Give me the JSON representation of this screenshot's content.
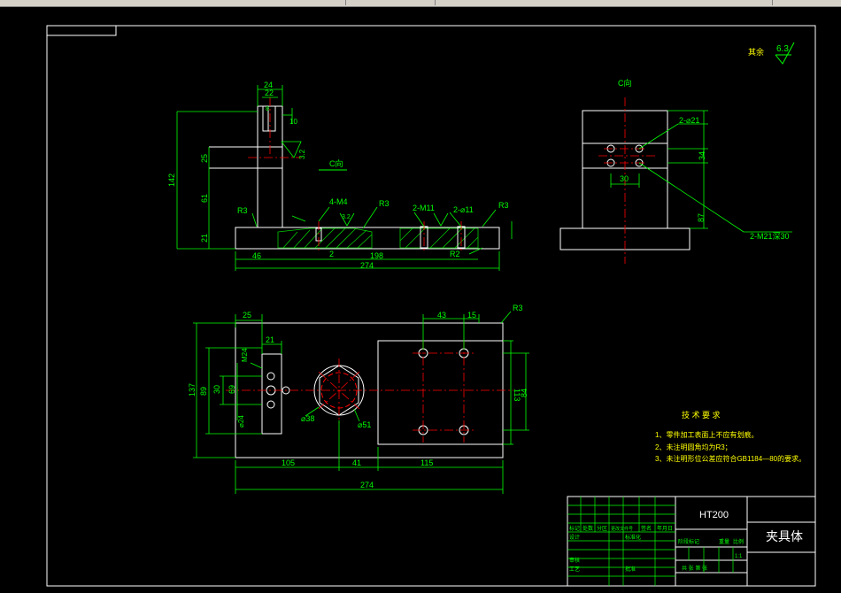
{
  "drawing": {
    "view_labels": {
      "c_view_top": "C向",
      "c_view_side": "C向"
    },
    "roughness": {
      "label": "其余",
      "value": "6.3"
    },
    "front_view": {
      "dims": {
        "d24": "24",
        "d22": "22",
        "d8": "8",
        "d10": "10",
        "d142": "142",
        "d25": "25",
        "d61": "61",
        "d21": "21",
        "d46": "46",
        "d198": "198",
        "d274": "274",
        "d2": "2",
        "d32": "3.2",
        "d32b": "3.2"
      },
      "callouts": {
        "r3_left": "R3",
        "m4": "4-M4",
        "r3_mid": "R3",
        "m11": "2-M11",
        "phi11": "2-⌀11",
        "r3_right": "R3",
        "r2": "R2"
      }
    },
    "side_view": {
      "callouts": {
        "phi21": "2-⌀21",
        "m21": "2-M21深30"
      },
      "dims": {
        "d30": "30",
        "d34": "34",
        "d87": "87"
      }
    },
    "plan_view": {
      "dims": {
        "d25": "25",
        "d21": "21",
        "d43": "43",
        "d15": "15",
        "d137": "137",
        "d89": "89",
        "d69": "69",
        "d30": "30",
        "d84": "84",
        "d113": "113",
        "d105": "105",
        "d41": "41",
        "d115": "115",
        "d274": "274",
        "phi38": "⌀38",
        "phi51": "⌀51",
        "m24": "M24",
        "phi24": "⌀24"
      },
      "callouts": {
        "r3": "R3"
      }
    },
    "tech_notes": {
      "title": "技 术 要 求",
      "items": [
        "1、零件加工表面上不应有划痕。",
        "2、未注明圆角均为R3；",
        "3、未注明形位公差应符合GB1184—80的要求。"
      ]
    },
    "title_block": {
      "material": "HT200",
      "part_name": "夹具体",
      "scale": "1:1",
      "cells": {
        "mark": "标记",
        "count": "处数",
        "zone": "分区",
        "change_doc": "更改文件号",
        "sign": "签名",
        "date": "年月日",
        "design": "设计",
        "standard": "标准化",
        "stage_mark": "阶段标记",
        "weight": "重量",
        "ratio": "比例",
        "review": "审核",
        "process": "工艺",
        "approve": "批准",
        "total": "共 张 第 张"
      }
    },
    "colors": {
      "background": "#000000",
      "outline": "#ffffff",
      "dimension": "#00ff00",
      "centerline": "#ff0000",
      "hatch": "#00cc00",
      "annotation": "#ffff00"
    }
  }
}
